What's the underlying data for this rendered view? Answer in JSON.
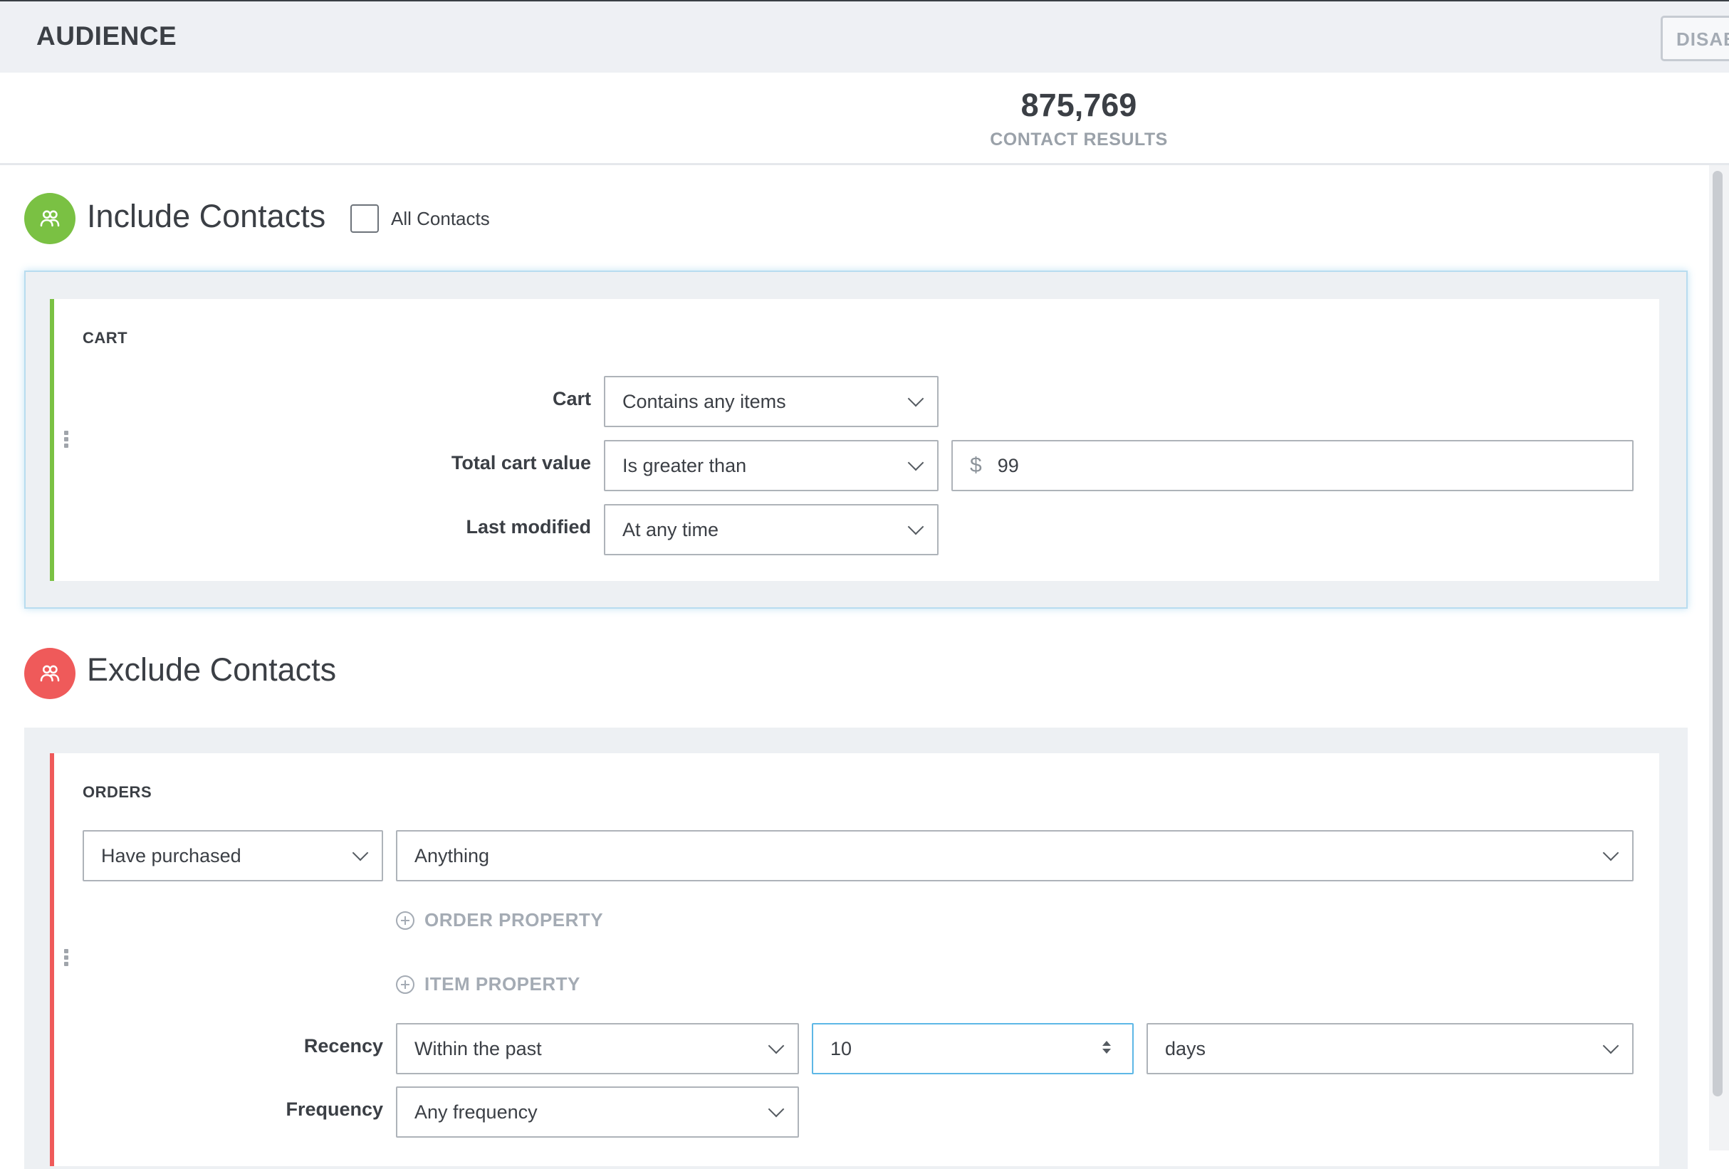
{
  "header": {
    "title": "AUDIENCE",
    "disable_button": "DISAB"
  },
  "results": {
    "count": "875,769",
    "label": "CONTACT RESULTS"
  },
  "include": {
    "title": "Include Contacts",
    "all_contacts_label": "All Contacts",
    "all_contacts_checked": false,
    "card": {
      "title": "CART",
      "rows": [
        {
          "label": "Cart",
          "select": "Contains any items"
        },
        {
          "label": "Total cart value",
          "select": "Is greater than",
          "currency": "$",
          "value": "99"
        },
        {
          "label": "Last modified",
          "select": "At any time"
        }
      ]
    }
  },
  "exclude": {
    "title": "Exclude Contacts",
    "card": {
      "title": "ORDERS",
      "purchase_select": "Have purchased",
      "item_select": "Anything",
      "order_property": "ORDER PROPERTY",
      "item_property": "ITEM PROPERTY",
      "recency": {
        "label": "Recency",
        "select": "Within the past",
        "value": "10",
        "unit": "days"
      },
      "frequency": {
        "label": "Frequency",
        "select": "Any frequency"
      }
    }
  },
  "colors": {
    "include_accent": "#7ac143",
    "exclude_accent": "#ef5a5a",
    "focus_border": "#5db7e6"
  },
  "icons": {
    "include": "people-icon",
    "exclude": "people-icon"
  }
}
